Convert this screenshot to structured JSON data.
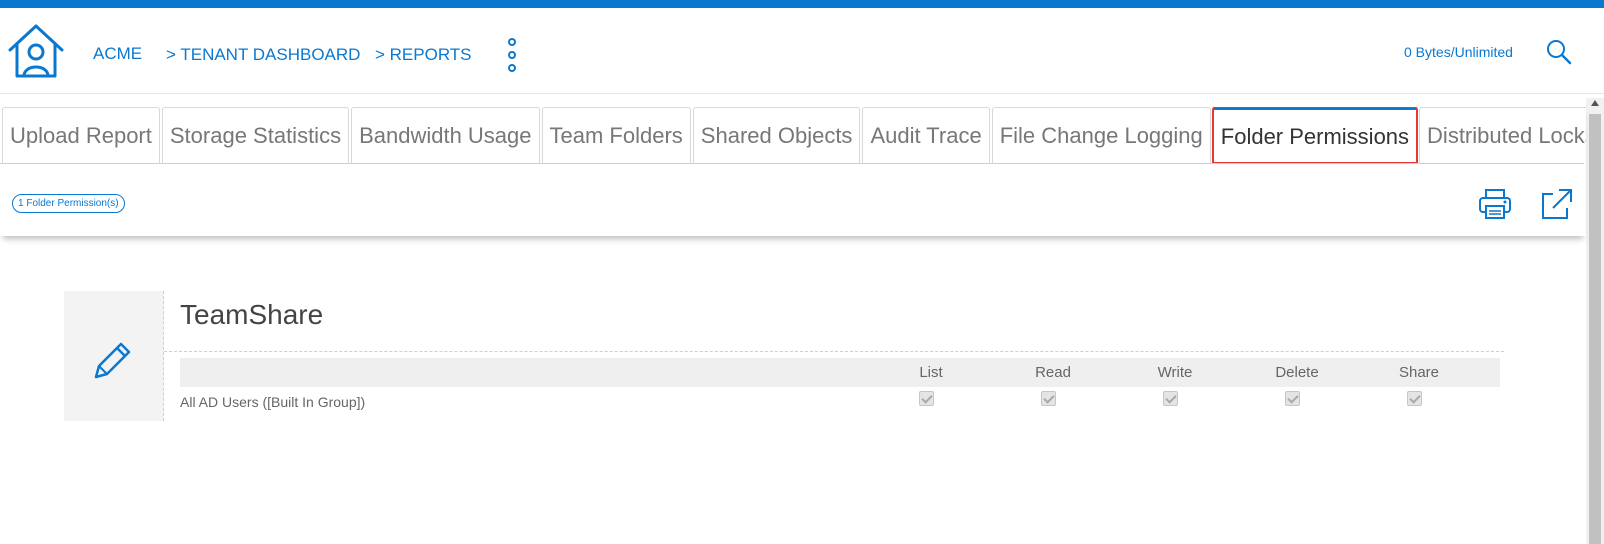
{
  "header": {
    "breadcrumb": [
      "ACME",
      "> TENANT DASHBOARD",
      "> REPORTS"
    ],
    "quota": "0 Bytes/Unlimited",
    "accent_color": "#0b78d0"
  },
  "tabs": [
    {
      "label": "Upload Report",
      "active": false
    },
    {
      "label": "Storage Statistics",
      "active": false
    },
    {
      "label": "Bandwidth Usage",
      "active": false
    },
    {
      "label": "Team Folders",
      "active": false
    },
    {
      "label": "Shared Objects",
      "active": false
    },
    {
      "label": "Audit Trace",
      "active": false
    },
    {
      "label": "File Change Logging",
      "active": false
    },
    {
      "label": "Folder Permissions",
      "active": true
    },
    {
      "label": "Distributed Locks",
      "active": false
    }
  ],
  "report": {
    "count_badge": "1 Folder Permission(s)",
    "folder": {
      "name": "TeamShare",
      "columns": [
        "List",
        "Read",
        "Write",
        "Delete",
        "Share"
      ],
      "rows": [
        {
          "principal": "All AD Users ([Built In Group])",
          "checked": [
            true,
            true,
            true,
            true,
            true
          ]
        }
      ]
    }
  },
  "icons": [
    "home-icon",
    "kebab-menu-icon",
    "search-icon",
    "print-icon",
    "export-icon",
    "edit-pencil-icon"
  ]
}
